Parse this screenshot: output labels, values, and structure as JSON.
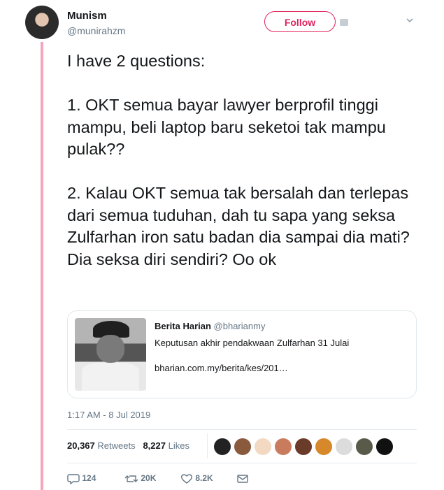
{
  "user": {
    "name": "Munism",
    "handle": "@munirahzm"
  },
  "follow_label": "Follow",
  "tweet_text": "I have 2 questions:\n\n1. OKT semua bayar lawyer berprofil tinggi mampu, beli laptop baru seketoi tak mampu pulak??\n\n2. Kalau OKT semua tak bersalah dan terlepas dari semua tuduhan, dah tu sapa yang seksa Zulfarhan iron satu badan dia sampai dia mati? Dia seksa diri sendiri? Oo ok",
  "card": {
    "source_name": "Berita Harian",
    "source_handle": "@bharianmy",
    "headline": "Keputusan akhir pendakwaan Zulfarhan 31 Julai",
    "link": "bharian.com.my/berita/kes/201…"
  },
  "timestamp": "1:17 AM - 8 Jul 2019",
  "stats": {
    "retweets_count": "20,367",
    "retweets_label": "Retweets",
    "likes_count": "8,227",
    "likes_label": "Likes"
  },
  "likers": [
    {
      "color": "#222222"
    },
    {
      "color": "#8a5a3c"
    },
    {
      "color": "#f3d9c2"
    },
    {
      "color": "#c97c5d"
    },
    {
      "color": "#6b3b2a"
    },
    {
      "color": "#d6882a"
    },
    {
      "color": "#dcdcdc"
    },
    {
      "color": "#5a5a4a"
    },
    {
      "color": "#111111"
    }
  ],
  "actions": {
    "replies": "124",
    "retweets": "20K",
    "likes": "8.2K"
  },
  "icons": {
    "reply": "reply-icon",
    "retweet": "retweet-icon",
    "like": "heart-icon",
    "dm": "envelope-icon",
    "caret": "chevron-down-icon"
  },
  "colors": {
    "accent": "#e0245e",
    "thread": "#f4a6bd",
    "muted": "#657786"
  }
}
